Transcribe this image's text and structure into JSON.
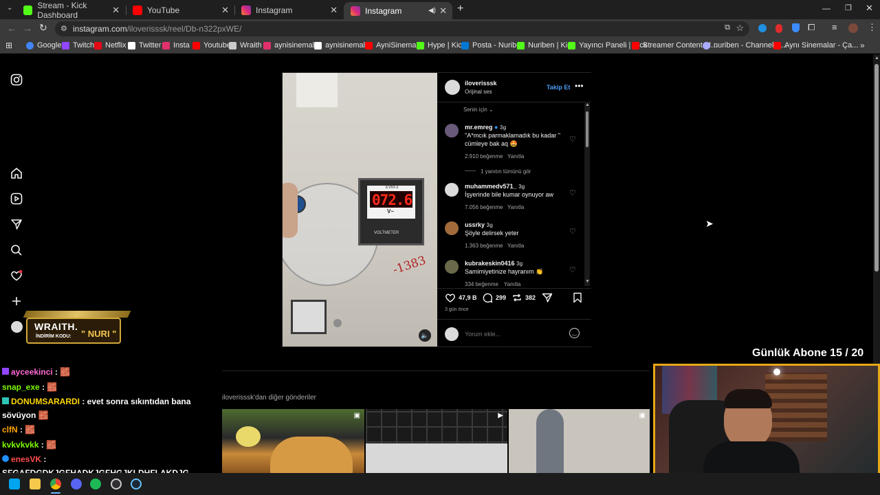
{
  "browser": {
    "tabs": [
      {
        "title": "Stream - Kick Dashboard",
        "color": "#53fc18"
      },
      {
        "title": "YouTube",
        "color": "#ff0000"
      },
      {
        "title": "Instagram",
        "color": "#e1306c"
      },
      {
        "title": "Instagram",
        "color": "#e1306c"
      }
    ],
    "url_host": "instagram.com",
    "url_path": "/iloverisssk/reel/Db-n322pxWE/",
    "bookmarks": [
      {
        "label": "Google",
        "color": "#4285f4"
      },
      {
        "label": "Twitch",
        "color": "#9146ff"
      },
      {
        "label": "Netflix",
        "color": "#e50914"
      },
      {
        "label": "Twitter",
        "color": "#ffffff"
      },
      {
        "label": "Insta",
        "color": "#e1306c"
      },
      {
        "label": "Youtube",
        "color": "#ff0000"
      },
      {
        "label": "Wraith",
        "color": "#cccccc"
      },
      {
        "label": "aynisinemalar",
        "color": "#e1306c"
      },
      {
        "label": "aynisinemalar",
        "color": "#ffffff"
      },
      {
        "label": "AyniSinemalar",
        "color": "#ff0000"
      },
      {
        "label": "Hype | Kick",
        "color": "#53fc18"
      },
      {
        "label": "Posta - Nuriben",
        "color": "#0078d4"
      },
      {
        "label": "Nuriben | Kick",
        "color": "#53fc18"
      },
      {
        "label": "Yayıncı Paneli | Kick",
        "color": "#53fc18"
      },
      {
        "label": "Streamer Content M...",
        "color": "#ff0000"
      },
      {
        "label": "nuriben - Channel S...",
        "color": "#aaaaff"
      },
      {
        "label": "Aynı Sinemalar - Ça...",
        "color": "#ff0000"
      }
    ]
  },
  "post": {
    "username": "iloverisssk",
    "audio": "Orijinal ses",
    "follow": "Takip Et",
    "sort": "Senin için",
    "comments": [
      {
        "user": "mr.emreg",
        "time": "3g",
        "text1": "\"A*mcık parmaklamadık bu kadar \"",
        "text2": "cümleye bak aq 🤩",
        "likes": "2.910 beğenme",
        "reply": "Yanıtla",
        "thread": "1 yanıtın tümünü gör"
      },
      {
        "user": "muhammedv571_",
        "time": "3g",
        "text1": "İşyerinde bile kumar oynuyor aw",
        "likes": "7.056 beğenme",
        "reply": "Yanıtla"
      },
      {
        "user": "ussrky",
        "time": "3g",
        "text1": "Şöyle delirsek yeter",
        "likes": "1.363 beğenme",
        "reply": "Yanıtla"
      },
      {
        "user": "kubrakeskin0416",
        "time": "3g",
        "text1": "Samimiyetinize hayranım 👏",
        "likes": "334 beğenme",
        "reply": "Yanıtla"
      }
    ],
    "like_count": "47,9 B",
    "comment_count": "299",
    "repost_count": "382",
    "posted": "3 gün önce",
    "comment_placeholder": "Yorum ekle...",
    "meter_value": "072.6",
    "meter_label": "EVM-3",
    "meter_unit": "V~",
    "meter_brand": "VOLTMETER",
    "handwriting": "-1383"
  },
  "more_posts_title": "iloverisssk'dan diğer gönderiler",
  "overlay": {
    "sponsor_name": "WRAITH.",
    "sponsor_code_label": "İNDİRİM KODU:",
    "sponsor_code": "\" NURI \"",
    "sub_goal": "Günlük Abone 15 / 20"
  },
  "chat": [
    {
      "user": "ayceekinci",
      "msg": " : 🧱",
      "color": "#ff6ad5"
    },
    {
      "user": "snap_exe",
      "msg": " : 🧱",
      "color": "#7cfc00"
    },
    {
      "user": "DONUMSARARDI",
      "msg": " : evet sonra sıkıntıdan bana",
      "color": "#ffd700"
    },
    {
      "user": "",
      "msg": "sövüyon 🧱",
      "color": "#ffffff"
    },
    {
      "user": "clfN",
      "msg": " : 🧱",
      "color": "#ffa500"
    },
    {
      "user": "kvkvkvkk",
      "msg": " : 🧱",
      "color": "#7cfc00"
    },
    {
      "user": "enesVK",
      "msg": " :",
      "color": "#ff4d4d"
    },
    {
      "user": "",
      "msg": "SFGAFDGDKJGFHADKJGFHGJKLDHFLAKDJG",
      "color": "#ffffff"
    }
  ]
}
